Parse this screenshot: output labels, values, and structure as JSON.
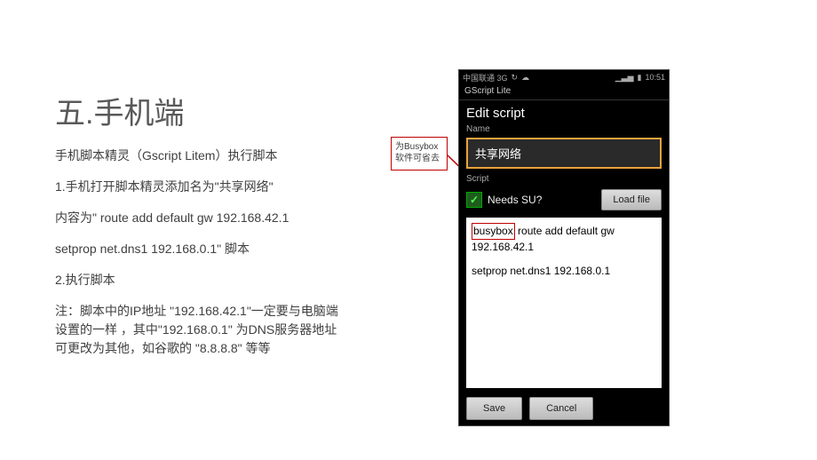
{
  "left": {
    "title": "五.手机端",
    "p1": "手机脚本精灵（Gscript Litem）执行脚本",
    "p2": "1.手机打开脚本精灵添加名为\"共享网络\"",
    "p3": "内容为\" route add default gw 192.168.42.1",
    "p4": "setprop net.dns1 192.168.0.1\" 脚本",
    "p5": "2.执行脚本",
    "p6": "注：脚本中的IP地址 \"192.168.42.1\"一定要与电脑端设置的一样 ，其中\"192.168.0.1\" 为DNS服务器地址可更改为其他，如谷歌的 \"8.8.8.8\" 等等"
  },
  "callout": {
    "text": "为Busybox软件可省去"
  },
  "phone": {
    "status": {
      "carrier": "中国联通 3G",
      "time": "10:51"
    },
    "appTitle": "GScript Lite",
    "screenTitle": "Edit script",
    "nameLabel": "Name",
    "nameValue": "共享网络",
    "scriptLabel": "Script",
    "needsSu": "Needs SU?",
    "loadFile": "Load file",
    "script": {
      "busybox": "busybox",
      "line1rest": " route add default gw 192.168.42.1",
      "line2": "setprop net.dns1 192.168.0.1"
    },
    "save": "Save",
    "cancel": "Cancel"
  }
}
